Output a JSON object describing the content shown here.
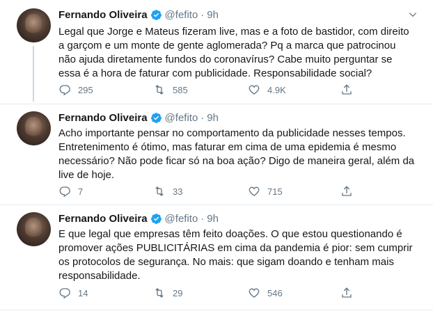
{
  "tweets": [
    {
      "name": "Fernando Oliveira",
      "handle": "@fefito",
      "separator": "·",
      "time": "9h",
      "text": "Legal que Jorge e Mateus fizeram live, mas e a foto de bastidor, com direito\na garçom e um monte de gente aglomerada? Pq a marca que patrocinou\nnão ajuda diretamente fundos do coronavírus? Cabe muito perguntar se\nessa é a hora de faturar com publicidade. Responsabilidade social?",
      "replies": "295",
      "retweets": "585",
      "likes": "4.9K"
    },
    {
      "name": "Fernando Oliveira",
      "handle": "@fefito",
      "separator": "·",
      "time": "9h",
      "text": "Acho importante pensar no comportamento da publicidade nesses tempos.\nEntretenimento é ótimo, mas faturar em cima de uma epidemia é mesmo\nnecessário? Não pode ficar só na boa ação? Digo de maneira geral, além da\nlive de hoje.",
      "replies": "7",
      "retweets": "33",
      "likes": "715"
    },
    {
      "name": "Fernando Oliveira",
      "handle": "@fefito",
      "separator": "·",
      "time": "9h",
      "text": "E que legal que empresas têm feito doações. O que estou questionando é\npromover ações PUBLICITÁRIAS em cima da pandemia é pior: sem cumprir\nos protocolos de segurança. No mais: que sigam doando e tenham mais\nresponsabilidade.",
      "replies": "14",
      "retweets": "29",
      "likes": "546"
    }
  ],
  "icons": {
    "reply": "reply-icon",
    "retweet": "retweet-icon",
    "like": "heart-icon",
    "share": "share-icon",
    "verified": "verified-badge-icon",
    "caret": "chevron-down-icon"
  },
  "colors": {
    "verified": "#1da1f2",
    "secondary_text": "#657786",
    "divider": "#e6ecf0"
  }
}
